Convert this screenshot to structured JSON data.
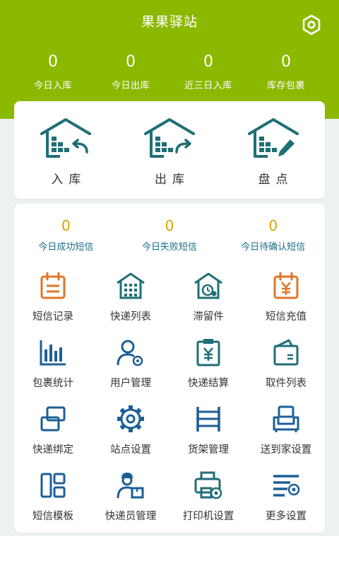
{
  "header": {
    "title": "果果驿站",
    "settings_icon": "settings-hex-icon",
    "color": "#8cb800",
    "stats": [
      {
        "value": "0",
        "label": "今日入库"
      },
      {
        "value": "0",
        "label": "今日出库"
      },
      {
        "value": "0",
        "label": "近三日入库"
      },
      {
        "value": "0",
        "label": "库存包裹"
      }
    ]
  },
  "operations": [
    {
      "label": "入库",
      "icon": "warehouse-in-icon"
    },
    {
      "label": "出库",
      "icon": "warehouse-out-icon"
    },
    {
      "label": "盘点",
      "icon": "warehouse-inventory-icon"
    }
  ],
  "sms_stats": [
    {
      "value": "0",
      "label": "今日成功短信"
    },
    {
      "value": "0",
      "label": "今日失败短信"
    },
    {
      "value": "0",
      "label": "今日待确认短信"
    }
  ],
  "grid": [
    {
      "label": "短信记录",
      "icon": "calendar-icon"
    },
    {
      "label": "快递列表",
      "icon": "building-icon"
    },
    {
      "label": "滞留件",
      "icon": "clock-house-icon"
    },
    {
      "label": "短信充值",
      "icon": "yen-calendar-icon"
    },
    {
      "label": "包裹统计",
      "icon": "bar-chart-icon"
    },
    {
      "label": "用户管理",
      "icon": "user-gear-icon"
    },
    {
      "label": "快递结算",
      "icon": "yen-clipboard-icon"
    },
    {
      "label": "取件列表",
      "icon": "wallet-icon"
    },
    {
      "label": "快递绑定",
      "icon": "link-squares-icon"
    },
    {
      "label": "站点设置",
      "icon": "gear-icon"
    },
    {
      "label": "货架管理",
      "icon": "shelf-icon"
    },
    {
      "label": "送到家设置",
      "icon": "sofa-icon"
    },
    {
      "label": "短信模板",
      "icon": "layout-icon"
    },
    {
      "label": "快递员管理",
      "icon": "courier-icon"
    },
    {
      "label": "打印机设置",
      "icon": "printer-gear-icon"
    },
    {
      "label": "更多设置",
      "icon": "list-gear-icon"
    }
  ],
  "colors": {
    "accent_green": "#8cb800",
    "teal": "#1f6f76",
    "orange": "#e0762a",
    "blue": "#1c5f96",
    "sms_number": "#d9a300"
  }
}
